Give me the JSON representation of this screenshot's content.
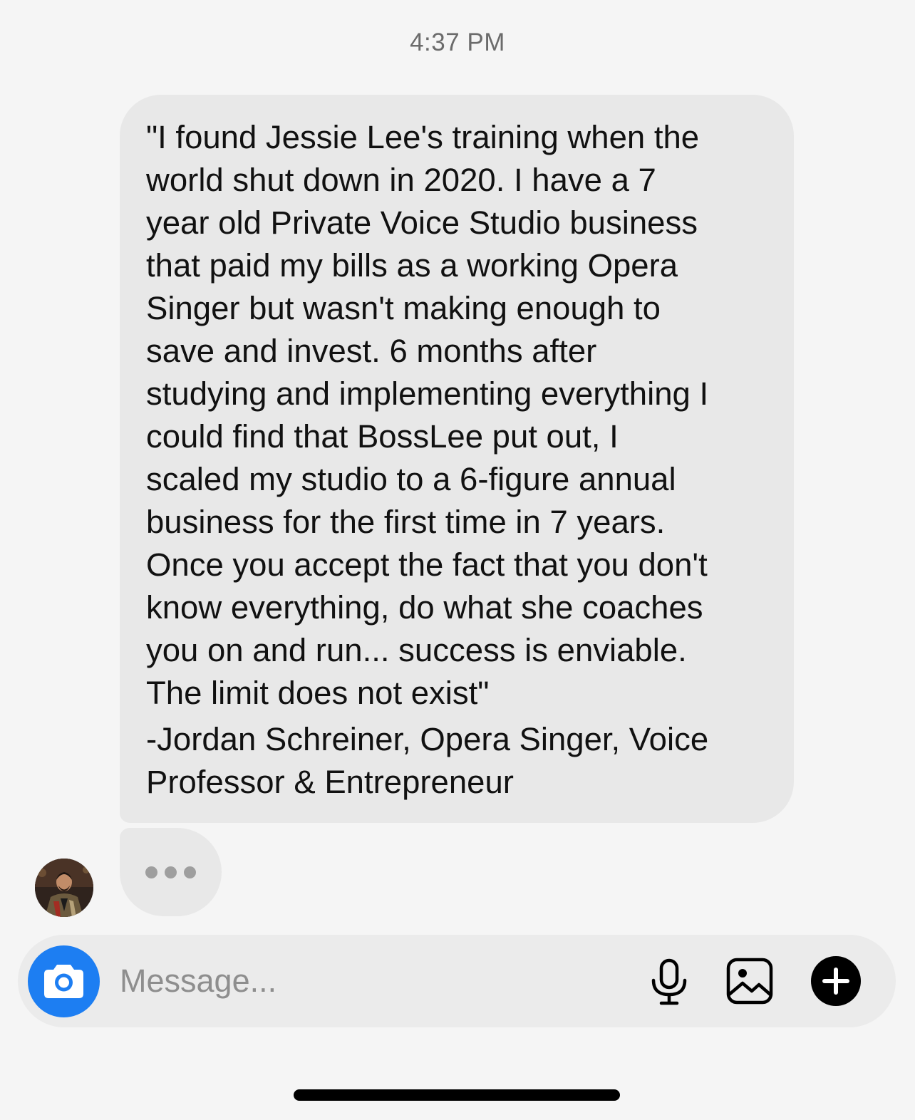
{
  "timestamp": "4:37 PM",
  "message": {
    "lines": [
      "\"I found Jessie Lee's training when the",
      "world shut down in 2020. I have a 7",
      "year old Private Voice Studio business",
      "that paid my bills as a working Opera",
      "Singer but wasn't making enough to",
      "save and invest. 6 months after",
      "studying and implementing everything I",
      "could find that BossLee put out, I",
      "scaled my studio to a 6-figure annual",
      "business for the first time in 7 years.",
      "Once you accept the fact that you don't",
      "know everything, do what she coaches",
      "you on and run... success is enviable.",
      "The limit does not exist\""
    ],
    "signature": [
      "-Jordan Schreiner, Opera Singer, Voice",
      "Professor & Entrepreneur"
    ]
  },
  "composer": {
    "placeholder": "Message...",
    "value": ""
  },
  "icons": {
    "camera": "camera-icon",
    "microphone": "microphone-icon",
    "gallery": "image-icon",
    "add": "plus-circle-icon"
  },
  "colors": {
    "accent": "#1d7ef2",
    "bubble": "#e8e8e8",
    "background": "#f5f5f5"
  }
}
